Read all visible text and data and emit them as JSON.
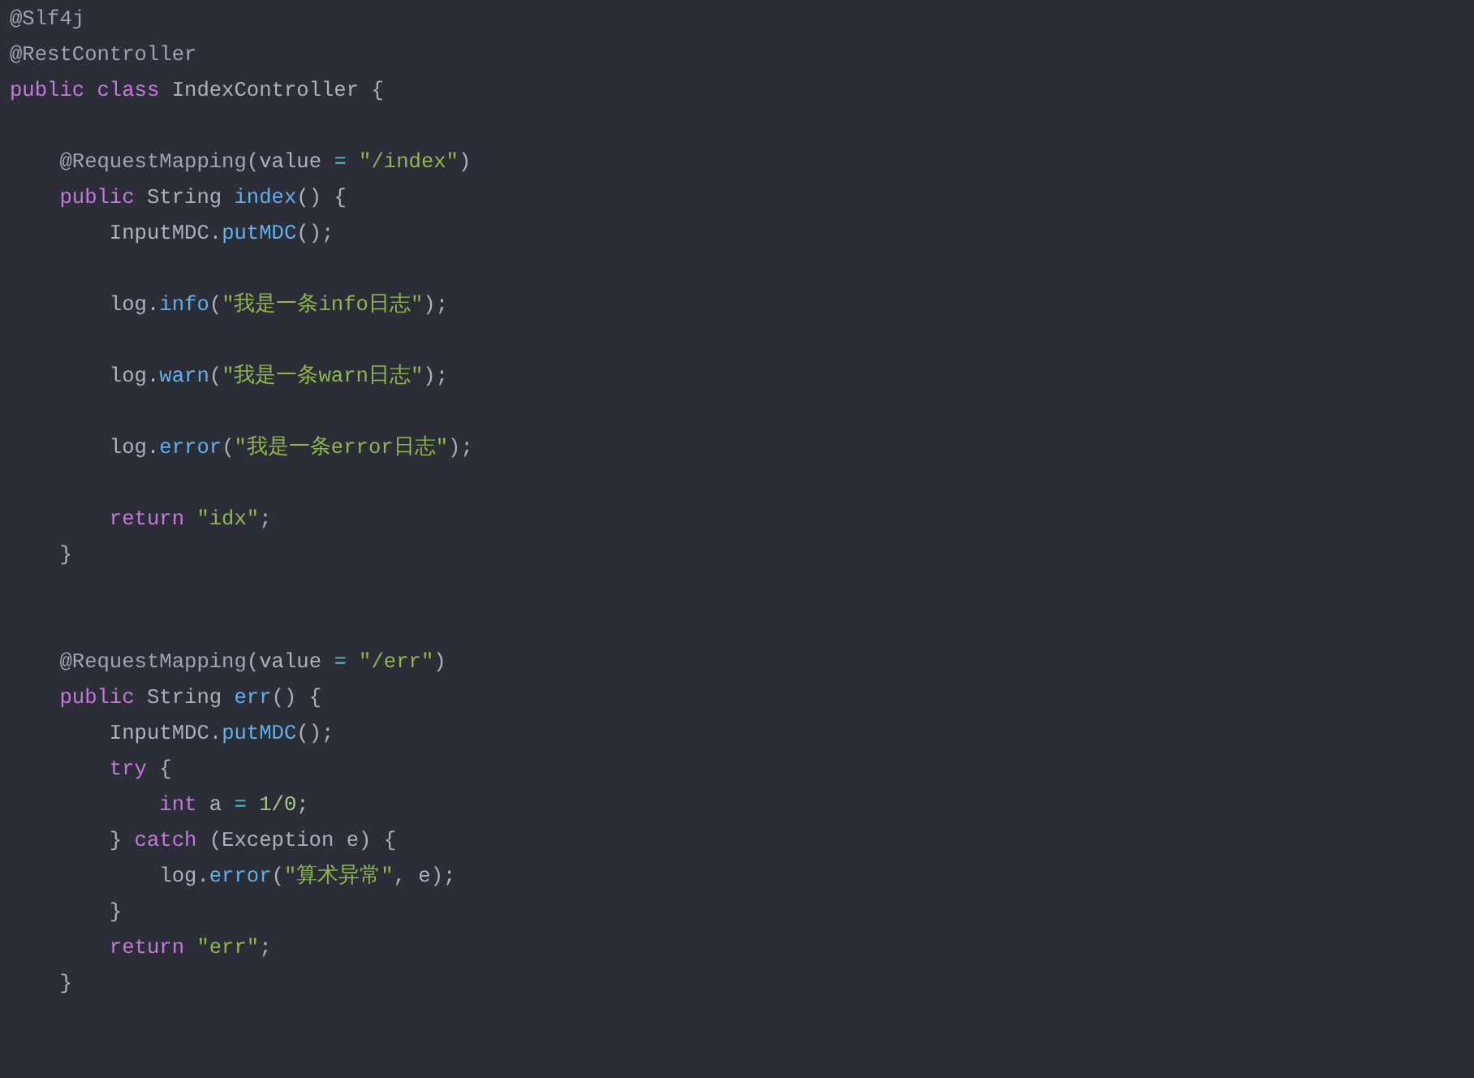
{
  "code": {
    "lines": [
      {
        "kind": "code",
        "tokens": [
          {
            "kind": "annotation",
            "text": "@Slf4j"
          }
        ]
      },
      {
        "kind": "code",
        "tokens": [
          {
            "kind": "annotation",
            "text": "@RestController"
          }
        ]
      },
      {
        "kind": "code",
        "tokens": [
          {
            "kind": "keyword",
            "text": "public class "
          },
          {
            "kind": "plain",
            "text": "IndexController {"
          }
        ]
      },
      {
        "kind": "blank"
      },
      {
        "kind": "code",
        "tokens": [
          {
            "kind": "annotation",
            "text": "    @RequestMapping"
          },
          {
            "kind": "plain",
            "text": "(value "
          },
          {
            "kind": "operator",
            "text": "= "
          },
          {
            "kind": "string",
            "text": "\"/index\""
          },
          {
            "kind": "plain",
            "text": ")"
          }
        ]
      },
      {
        "kind": "code",
        "tokens": [
          {
            "kind": "keyword",
            "text": "    public "
          },
          {
            "kind": "plain",
            "text": "String "
          },
          {
            "kind": "function",
            "text": "index"
          },
          {
            "kind": "plain",
            "text": "() {"
          }
        ]
      },
      {
        "kind": "code",
        "tokens": [
          {
            "kind": "plain",
            "text": "        InputMDC."
          },
          {
            "kind": "function",
            "text": "putMDC"
          },
          {
            "kind": "plain",
            "text": "();"
          }
        ]
      },
      {
        "kind": "blank"
      },
      {
        "kind": "code",
        "tokens": [
          {
            "kind": "plain",
            "text": "        log."
          },
          {
            "kind": "function",
            "text": "info"
          },
          {
            "kind": "plain",
            "text": "("
          },
          {
            "kind": "string",
            "text": "\"我是一条info日志\""
          },
          {
            "kind": "plain",
            "text": ");"
          }
        ]
      },
      {
        "kind": "blank"
      },
      {
        "kind": "code",
        "tokens": [
          {
            "kind": "plain",
            "text": "        log."
          },
          {
            "kind": "function",
            "text": "warn"
          },
          {
            "kind": "plain",
            "text": "("
          },
          {
            "kind": "string",
            "text": "\"我是一条warn日志\""
          },
          {
            "kind": "plain",
            "text": ");"
          }
        ]
      },
      {
        "kind": "blank"
      },
      {
        "kind": "code",
        "tokens": [
          {
            "kind": "plain",
            "text": "        log."
          },
          {
            "kind": "function",
            "text": "error"
          },
          {
            "kind": "plain",
            "text": "("
          },
          {
            "kind": "string",
            "text": "\"我是一条error日志\""
          },
          {
            "kind": "plain",
            "text": ");"
          }
        ]
      },
      {
        "kind": "blank"
      },
      {
        "kind": "code",
        "tokens": [
          {
            "kind": "keyword",
            "text": "        return "
          },
          {
            "kind": "string",
            "text": "\"idx\""
          },
          {
            "kind": "plain",
            "text": ";"
          }
        ]
      },
      {
        "kind": "code",
        "tokens": [
          {
            "kind": "plain",
            "text": "    }"
          }
        ]
      },
      {
        "kind": "blank"
      },
      {
        "kind": "blank"
      },
      {
        "kind": "code",
        "tokens": [
          {
            "kind": "annotation",
            "text": "    @RequestMapping"
          },
          {
            "kind": "plain",
            "text": "(value "
          },
          {
            "kind": "operator",
            "text": "= "
          },
          {
            "kind": "string",
            "text": "\"/err\""
          },
          {
            "kind": "plain",
            "text": ")"
          }
        ]
      },
      {
        "kind": "code",
        "tokens": [
          {
            "kind": "keyword",
            "text": "    public "
          },
          {
            "kind": "plain",
            "text": "String "
          },
          {
            "kind": "function",
            "text": "err"
          },
          {
            "kind": "plain",
            "text": "() {"
          }
        ]
      },
      {
        "kind": "code",
        "tokens": [
          {
            "kind": "plain",
            "text": "        InputMDC."
          },
          {
            "kind": "function",
            "text": "putMDC"
          },
          {
            "kind": "plain",
            "text": "();"
          }
        ]
      },
      {
        "kind": "code",
        "tokens": [
          {
            "kind": "keyword",
            "text": "        try "
          },
          {
            "kind": "plain",
            "text": "{"
          }
        ]
      },
      {
        "kind": "code",
        "tokens": [
          {
            "kind": "keyword",
            "text": "            int "
          },
          {
            "kind": "plain",
            "text": "a "
          },
          {
            "kind": "operator",
            "text": "= "
          },
          {
            "kind": "number",
            "text": "1/0"
          },
          {
            "kind": "plain",
            "text": ";"
          }
        ]
      },
      {
        "kind": "code",
        "tokens": [
          {
            "kind": "plain",
            "text": "        } "
          },
          {
            "kind": "keyword",
            "text": "catch "
          },
          {
            "kind": "plain",
            "text": "(Exception e) {"
          }
        ]
      },
      {
        "kind": "code",
        "tokens": [
          {
            "kind": "plain",
            "text": "            log."
          },
          {
            "kind": "function",
            "text": "error"
          },
          {
            "kind": "plain",
            "text": "("
          },
          {
            "kind": "string",
            "text": "\"算术异常\""
          },
          {
            "kind": "plain",
            "text": ", e);"
          }
        ]
      },
      {
        "kind": "code",
        "tokens": [
          {
            "kind": "plain",
            "text": "        }"
          }
        ]
      },
      {
        "kind": "code",
        "tokens": [
          {
            "kind": "keyword",
            "text": "        return "
          },
          {
            "kind": "string",
            "text": "\"err\""
          },
          {
            "kind": "plain",
            "text": ";"
          }
        ]
      },
      {
        "kind": "code",
        "tokens": [
          {
            "kind": "plain",
            "text": "    }"
          }
        ]
      }
    ]
  }
}
